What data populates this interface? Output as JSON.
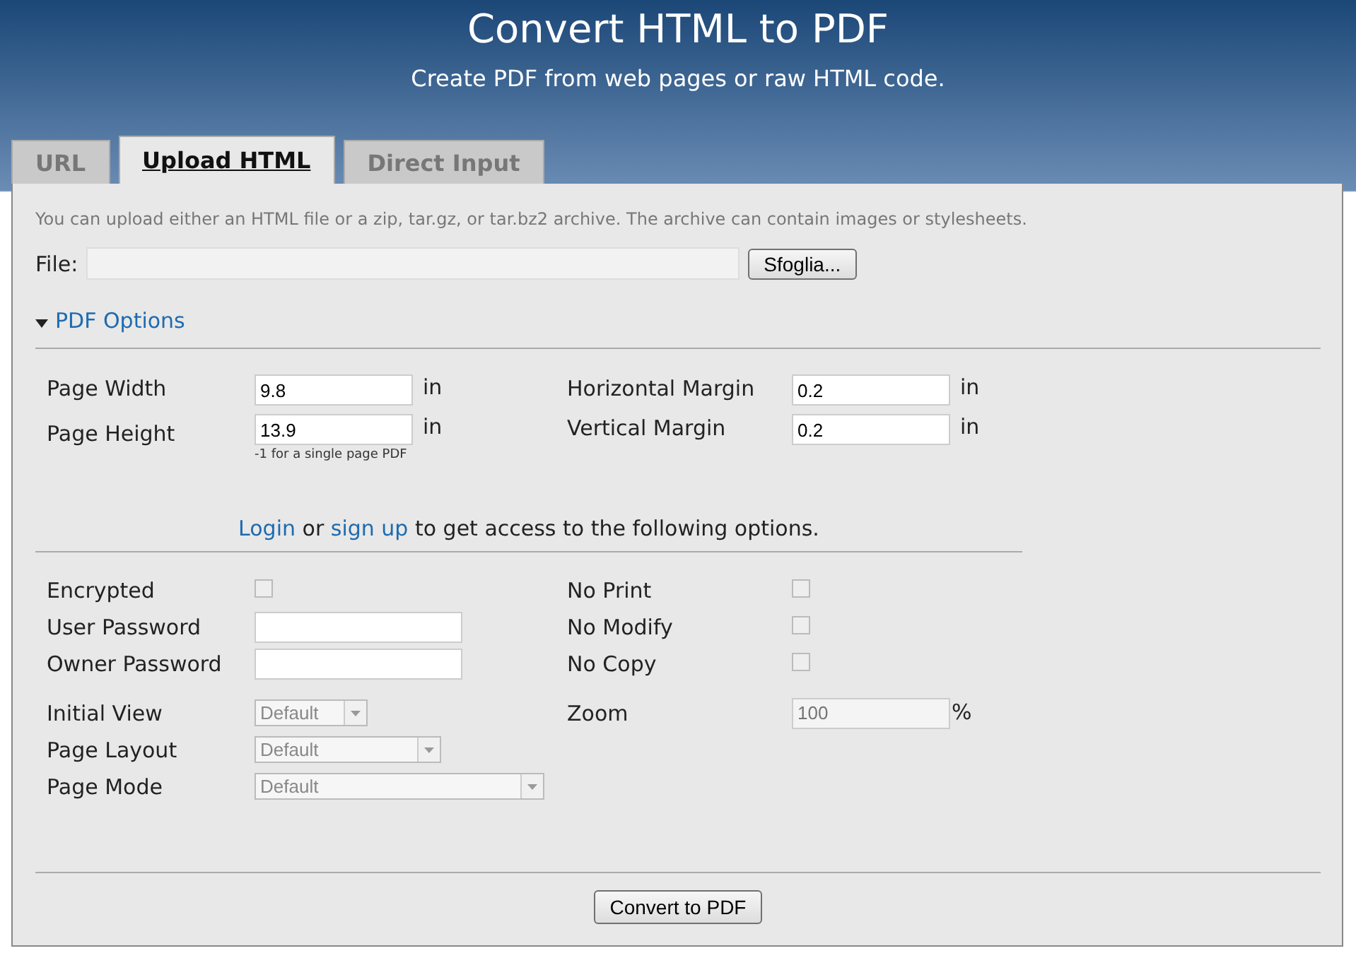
{
  "header": {
    "title": "Convert HTML to PDF",
    "subtitle": "Create PDF from web pages or raw HTML code."
  },
  "tabs": [
    {
      "label": "URL",
      "selected": false
    },
    {
      "label": "Upload HTML",
      "selected": true
    },
    {
      "label": "Direct Input",
      "selected": false
    }
  ],
  "panel": {
    "hint": "You can upload either an HTML file or a zip, tar.gz, or tar.bz2 archive. The archive can contain images or stylesheets.",
    "file": {
      "label": "File:",
      "button": "Sfoglia..."
    },
    "pdf_options": {
      "label": "PDF Options",
      "expanded": true
    },
    "dimensions_left": [
      {
        "label": "Page Width",
        "value": "9.8",
        "unit": "in"
      },
      {
        "label": "Page Height",
        "value": "13.9",
        "unit": "in",
        "note": "-1 for a single page PDF"
      }
    ],
    "dimensions_right": [
      {
        "label": "Horizontal Margin",
        "value": "0.2",
        "unit": "in"
      },
      {
        "label": "Vertical Margin",
        "value": "0.2",
        "unit": "in"
      }
    ],
    "login_prompt": [
      {
        "kind": "link",
        "text": "Login"
      },
      {
        "kind": "text",
        "text": " or "
      },
      {
        "kind": "link",
        "text": "sign up"
      },
      {
        "kind": "text",
        "text": " to get access to the following options."
      }
    ],
    "locked_groups": [
      {
        "left": [
          {
            "kind": "checkbox",
            "label": "Encrypted",
            "checked": false,
            "disabled": true
          },
          {
            "kind": "field",
            "label": "User Password"
          },
          {
            "kind": "field",
            "label": "Owner Password"
          }
        ],
        "right": [
          {
            "kind": "checkbox",
            "label": "No Print",
            "checked": false,
            "disabled": true
          },
          {
            "kind": "checkbox",
            "label": "No Modify",
            "checked": false,
            "disabled": true
          },
          {
            "kind": "checkbox",
            "label": "No Copy",
            "checked": false,
            "disabled": true
          }
        ]
      },
      {
        "left": [
          {
            "kind": "select",
            "label": "Initial View",
            "value": "Default",
            "disabled": true
          },
          {
            "kind": "select",
            "label": "Page Layout",
            "value": "Default",
            "disabled": true
          },
          {
            "kind": "select",
            "label": "Page Mode",
            "value": "Default",
            "disabled": true
          }
        ],
        "right": [
          {
            "kind": "number",
            "label": "Zoom",
            "placeholder": "100",
            "unit": "%",
            "disabled": true
          }
        ]
      }
    ],
    "submit": "Convert to PDF"
  }
}
